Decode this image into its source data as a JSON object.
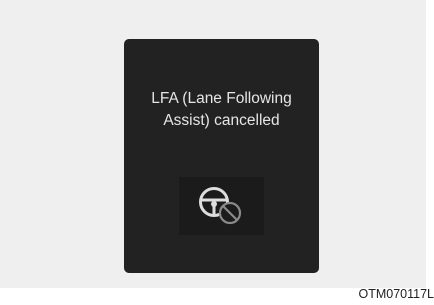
{
  "display": {
    "message_line1": "LFA (Lane Following",
    "message_line2": "Assist) cancelled",
    "icon": "steering-wheel-cancelled-icon"
  },
  "reference_code": "OTM070117L",
  "colors": {
    "screen_background": "#222222",
    "text": "#e6e6e6",
    "icon": "#dddddd",
    "prohibited_sign": "#8a8a8a",
    "page_background": "#efefef"
  }
}
